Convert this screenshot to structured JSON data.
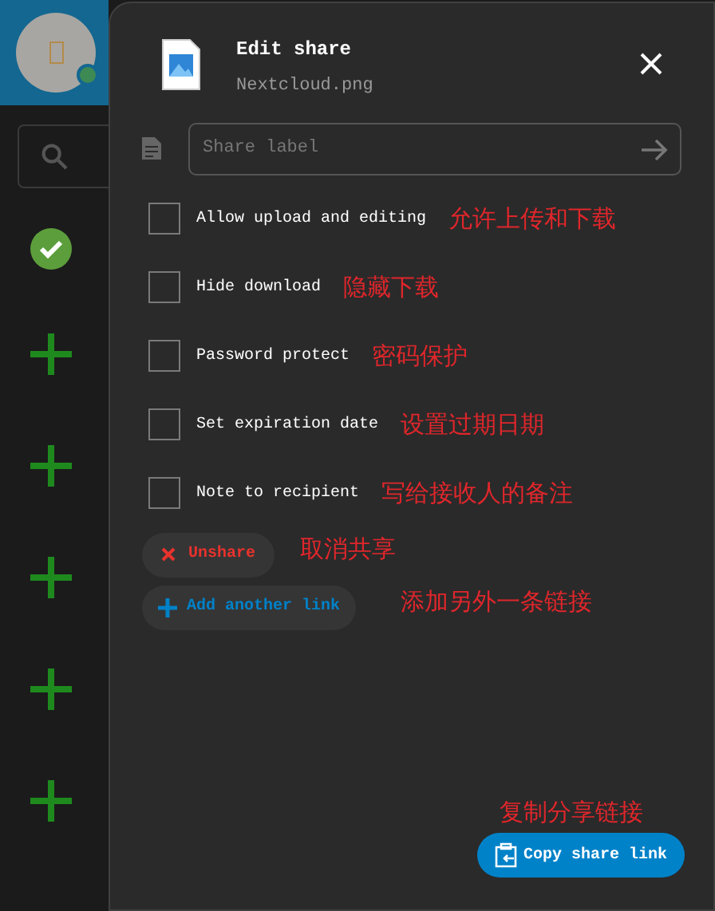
{
  "dialog": {
    "title": "Edit share",
    "filename": "Nextcloud.png",
    "label_field": {
      "placeholder": "Share label"
    },
    "options": [
      {
        "label": "Allow upload and editing",
        "checked": false,
        "note": "允许上传和下载"
      },
      {
        "label": "Hide download",
        "checked": false,
        "note": "隐藏下载"
      },
      {
        "label": "Password protect",
        "checked": false,
        "note": "密码保护"
      },
      {
        "label": "Set expiration date",
        "checked": false,
        "note": "设置过期日期"
      },
      {
        "label": "Note to recipient",
        "checked": false,
        "note": "写给接收人的备注"
      }
    ],
    "unshare": {
      "label": "Unshare",
      "note": "取消共享"
    },
    "add_link": {
      "label": "Add another link",
      "note": "添加另外一条链接"
    },
    "copy": {
      "label": "Copy share link",
      "note": "复制分享链接"
    }
  },
  "sidebar": {
    "items": [
      {
        "kind": "check"
      },
      {
        "kind": "add"
      },
      {
        "kind": "add"
      },
      {
        "kind": "add"
      },
      {
        "kind": "add"
      },
      {
        "kind": "add"
      }
    ]
  }
}
